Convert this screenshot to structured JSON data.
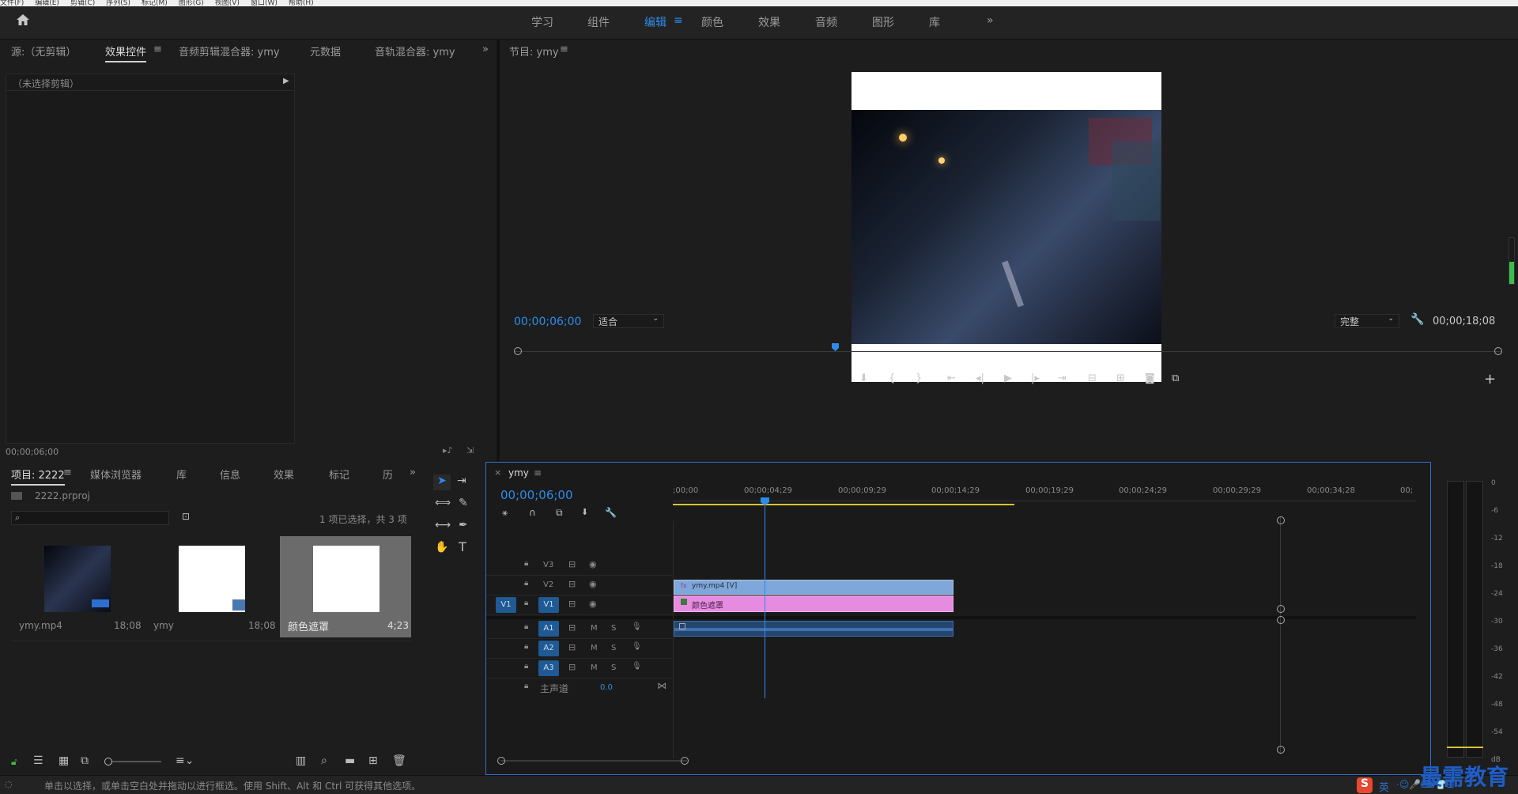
{
  "menubar": [
    "文件(F)",
    "编辑(E)",
    "剪辑(C)",
    "序列(S)",
    "标记(M)",
    "图形(G)",
    "视图(V)",
    "窗口(W)",
    "帮助(H)"
  ],
  "workspaces": [
    {
      "label": "学习",
      "active": false
    },
    {
      "label": "组件",
      "active": false
    },
    {
      "label": "编辑",
      "active": true
    },
    {
      "label": "颜色",
      "active": false
    },
    {
      "label": "效果",
      "active": false
    },
    {
      "label": "音频",
      "active": false
    },
    {
      "label": "图形",
      "active": false
    },
    {
      "label": "库",
      "active": false
    }
  ],
  "source_panel": {
    "tabs": [
      "源:（无剪辑）",
      "效果控件",
      "音频剪辑混合器: ymy",
      "元数据",
      "音轨混合器: ymy"
    ],
    "active_tab": "效果控件",
    "no_clip": "（未选择剪辑）",
    "timecode": "00;00;06;00"
  },
  "program": {
    "title": "节目: ymy",
    "timecode": "00;00;06;00",
    "fit": "适合",
    "quality": "完整",
    "duration": "00;00;18;08"
  },
  "project": {
    "tabs": [
      "项目: 2222",
      "媒体浏览器",
      "库",
      "信息",
      "效果",
      "标记",
      "历"
    ],
    "active_tab": "项目: 2222",
    "file": "2222.prproj",
    "selection_info": "1 项已选择，共 3 项",
    "search_placeholder": "",
    "items": [
      {
        "name": "ymy.mp4",
        "duration": "18;08"
      },
      {
        "name": "ymy",
        "duration": "18;08"
      },
      {
        "name": "颜色遮罩",
        "duration": "4;23"
      }
    ]
  },
  "timeline": {
    "title": "ymy",
    "timecode": "00;00;06;00",
    "ruler": [
      ";00;00",
      "00;00;04;29",
      "00;00;09;29",
      "00;00;14;29",
      "00;00;19;29",
      "00;00;24;29",
      "00;00;29;29",
      "00;00;34;28",
      "00;"
    ],
    "tracks": [
      {
        "id": "V3",
        "src": ""
      },
      {
        "id": "V2",
        "src": ""
      },
      {
        "id": "V1",
        "src": "V1"
      },
      {
        "id": "A1",
        "src": ""
      },
      {
        "id": "A2",
        "src": ""
      },
      {
        "id": "A3",
        "src": ""
      }
    ],
    "master_label": "主声道",
    "master_value": "0.0",
    "clip_video": "ymy.mp4 [V]",
    "clip_matte": "颜色遮罩",
    "ms": [
      "M",
      "S"
    ]
  },
  "meter_scale": [
    "0",
    "-6",
    "-12",
    "-18",
    "-24",
    "-30",
    "-36",
    "-42",
    "-48",
    "-54",
    "dB"
  ],
  "status": "单击以选择，或单击空白处并拖动以进行框选。使用 Shift、Alt 和 Ctrl 可获得其他选项。",
  "ime": {
    "logo": "S",
    "label": "英"
  },
  "watermark": "最需教育",
  "colors": {
    "accent": "#2d8ceb",
    "video_clip": "#7fa7d9",
    "matte_clip": "#e58ce0",
    "audio_clip": "#3d6fa8",
    "playhead": "#2d8ceb"
  }
}
